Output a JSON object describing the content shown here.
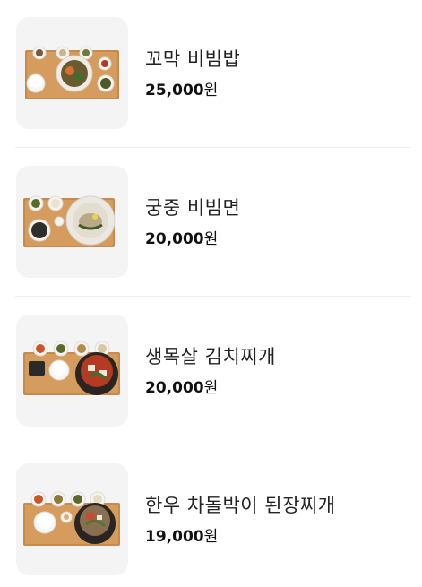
{
  "currency_unit": "원",
  "items": [
    {
      "name": "꼬막 비빔밥",
      "price": "25,000",
      "image": "bibimbap-tray-photo"
    },
    {
      "name": "궁중 비빔면",
      "price": "20,000",
      "image": "bibim-noodle-tray-photo"
    },
    {
      "name": "생목살 김치찌개",
      "price": "20,000",
      "image": "kimchi-stew-tray-photo"
    },
    {
      "name": "한우 차돌박이 된장찌개",
      "price": "19,000",
      "image": "doenjang-stew-tray-photo"
    }
  ]
}
